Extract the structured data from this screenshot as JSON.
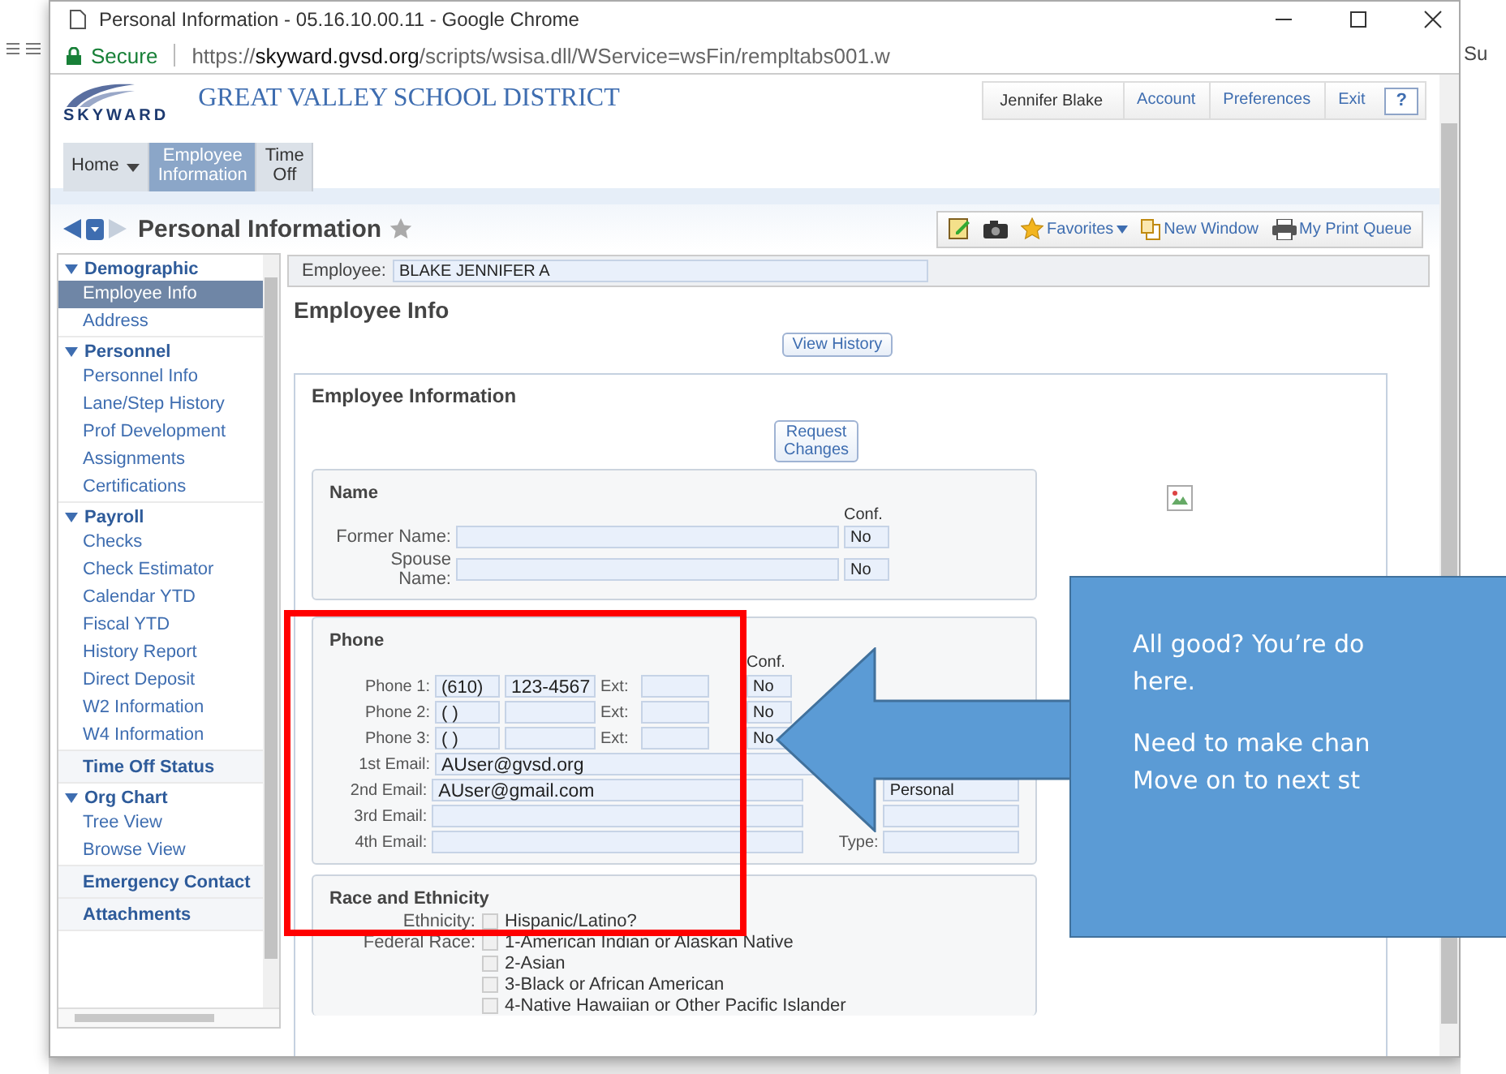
{
  "browser": {
    "title": "Personal Information - 05.16.10.00.11 - Google Chrome",
    "secure_label": "Secure",
    "url_scheme": "https://",
    "url_host": "skyward.gvsd.org",
    "url_path": "/scripts/wsisa.dll/WService=wsFin/rempltabs001.w"
  },
  "background_app": {
    "text": "Su"
  },
  "header": {
    "logo_text": "SKYWARD",
    "district": "GREAT VALLEY SCHOOL DISTRICT",
    "user_menu": [
      "Jennifer Blake",
      "Account",
      "Preferences",
      "Exit"
    ],
    "help": "?"
  },
  "nav_tabs": [
    {
      "label": "Home",
      "selected": false,
      "dropdown": true
    },
    {
      "label": "Employee\nInformation",
      "selected": true,
      "dropdown": false
    },
    {
      "label": "Time\nOff",
      "selected": false,
      "dropdown": false
    }
  ],
  "page_title": "Personal Information",
  "toolbar": {
    "favorites": "Favorites",
    "new_window": "New Window",
    "print_queue": "My Print Queue"
  },
  "sidebar": [
    {
      "kind": "collapsible",
      "label": "Demographic",
      "expanded": true,
      "items": [
        {
          "label": "Employee Info",
          "selected": true
        },
        {
          "label": "Address",
          "selected": false
        }
      ]
    },
    {
      "kind": "collapsible",
      "label": "Personnel",
      "expanded": true,
      "items": [
        {
          "label": "Personnel Info",
          "selected": false
        },
        {
          "label": "Lane/Step History",
          "selected": false
        },
        {
          "label": "Prof Development",
          "selected": false
        },
        {
          "label": "Assignments",
          "selected": false
        },
        {
          "label": "Certifications",
          "selected": false
        }
      ]
    },
    {
      "kind": "collapsible",
      "label": "Payroll",
      "expanded": true,
      "items": [
        {
          "label": "Checks",
          "selected": false
        },
        {
          "label": "Check Estimator",
          "selected": false
        },
        {
          "label": "Calendar YTD",
          "selected": false
        },
        {
          "label": "Fiscal YTD",
          "selected": false
        },
        {
          "label": "History Report",
          "selected": false
        },
        {
          "label": "Direct Deposit",
          "selected": false
        },
        {
          "label": "W2 Information",
          "selected": false
        },
        {
          "label": "W4 Information",
          "selected": false
        }
      ]
    },
    {
      "kind": "link",
      "label": "Time Off Status"
    },
    {
      "kind": "collapsible",
      "label": "Org Chart",
      "expanded": true,
      "items": [
        {
          "label": "Tree View",
          "selected": false
        },
        {
          "label": "Browse View",
          "selected": false
        }
      ]
    },
    {
      "kind": "link",
      "label": "Emergency Contact"
    },
    {
      "kind": "link",
      "label": "Attachments"
    }
  ],
  "employee": {
    "label": "Employee:",
    "value": "BLAKE JENNIFER A"
  },
  "heading": "Employee Info",
  "view_history": "View History",
  "panel_title": "Employee Information",
  "request_changes": "Request\nChanges",
  "name_section": {
    "title": "Name",
    "conf_header": "Conf.",
    "rows": [
      {
        "label": "Former Name:",
        "conf": "No"
      },
      {
        "label": "Spouse\nName:",
        "conf": "No"
      }
    ]
  },
  "phone_section": {
    "title": "Phone",
    "conf_header": "Conf.",
    "phones": [
      {
        "label": "Phone 1:",
        "area": "(610)",
        "number": "123-4567",
        "ext_label": "Ext:",
        "conf": "No"
      },
      {
        "label": "Phone 2:",
        "area": "(   )",
        "ext_label": "Ext:",
        "conf": "No"
      },
      {
        "label": "Phone 3:",
        "area": "(   )",
        "ext_label": "Ext:",
        "conf": "No"
      }
    ],
    "emails": [
      {
        "label": "1st Email:",
        "value": "AUser@gvsd.org"
      },
      {
        "label": "2nd Email:",
        "value": "AUser@gmail.com",
        "type_field": true,
        "type": "Personal"
      },
      {
        "label": "3rd Email:",
        "type_field": true
      },
      {
        "label": "4th Email:",
        "type_field": true,
        "type_label": "Type:"
      }
    ]
  },
  "race_section": {
    "title": "Race and Ethnicity",
    "rows": [
      {
        "label": "Ethnicity:",
        "option": "Hispanic/Latino?",
        "checked": false
      },
      {
        "label": "Federal Race:",
        "option": "1-American Indian or Alaskan Native",
        "checked": false
      },
      {
        "option": "2-Asian",
        "checked": false
      },
      {
        "option": "3-Black or African American",
        "checked": false
      },
      {
        "option": "4-Native Hawaiian or Other Pacific Islander",
        "checked": false
      }
    ]
  },
  "callout": {
    "paragraphs": [
      "All good? You’re do\nhere.",
      "Need to make chan\nMove on to next st"
    ]
  }
}
